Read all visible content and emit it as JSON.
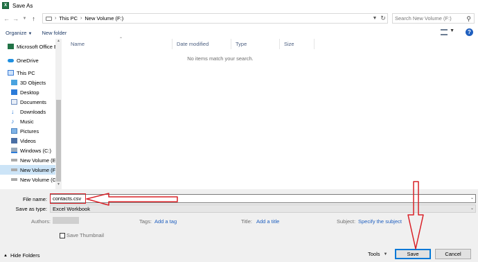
{
  "window": {
    "title": "Save As",
    "app_icon_letter": "X"
  },
  "address_bar": {
    "path": [
      "This PC",
      "New Volume (F:)"
    ],
    "search_placeholder": "Search New Volume (F:)"
  },
  "toolbar": {
    "organize_label": "Organize",
    "new_folder_label": "New folder"
  },
  "nav_pane": {
    "items": [
      {
        "label": "Microsoft Office E",
        "icon": "excel-icon"
      },
      {
        "label": "OneDrive",
        "icon": "cloud-icon"
      },
      {
        "label": "This PC",
        "icon": "computer-icon"
      },
      {
        "label": "3D Objects",
        "icon": "cube-icon"
      },
      {
        "label": "Desktop",
        "icon": "desktop-icon"
      },
      {
        "label": "Documents",
        "icon": "document-icon"
      },
      {
        "label": "Downloads",
        "icon": "download-icon"
      },
      {
        "label": "Music",
        "icon": "music-icon"
      },
      {
        "label": "Pictures",
        "icon": "picture-icon"
      },
      {
        "label": "Videos",
        "icon": "video-icon"
      },
      {
        "label": "Windows (C:)",
        "icon": "drive-icon"
      },
      {
        "label": "New Volume (E:)",
        "icon": "drive-icon"
      },
      {
        "label": "New Volume (F:)",
        "icon": "drive-icon",
        "selected": true
      },
      {
        "label": "New Volume (G:)",
        "icon": "drive-icon"
      }
    ]
  },
  "file_list": {
    "columns": [
      "Name",
      "Date modified",
      "Type",
      "Size"
    ],
    "empty_message": "No items match your search."
  },
  "save_form": {
    "file_name_label": "File name:",
    "file_name_value": "contacts.csv",
    "save_as_type_label": "Save as type:",
    "save_as_type_value": "Excel Workbook",
    "authors_label": "Authors:",
    "tags_label": "Tags:",
    "tags_link": "Add a tag",
    "title_label": "Title:",
    "title_link": "Add a title",
    "subject_label": "Subject:",
    "subject_link": "Specify the subject",
    "save_thumbnail_label": "Save Thumbnail",
    "hide_folders_label": "Hide Folders",
    "tools_label": "Tools",
    "save_button": "Save",
    "cancel_button": "Cancel"
  },
  "colors": {
    "accent": "#0078d7",
    "annotation": "#d92027",
    "link": "#1f5fbf"
  }
}
